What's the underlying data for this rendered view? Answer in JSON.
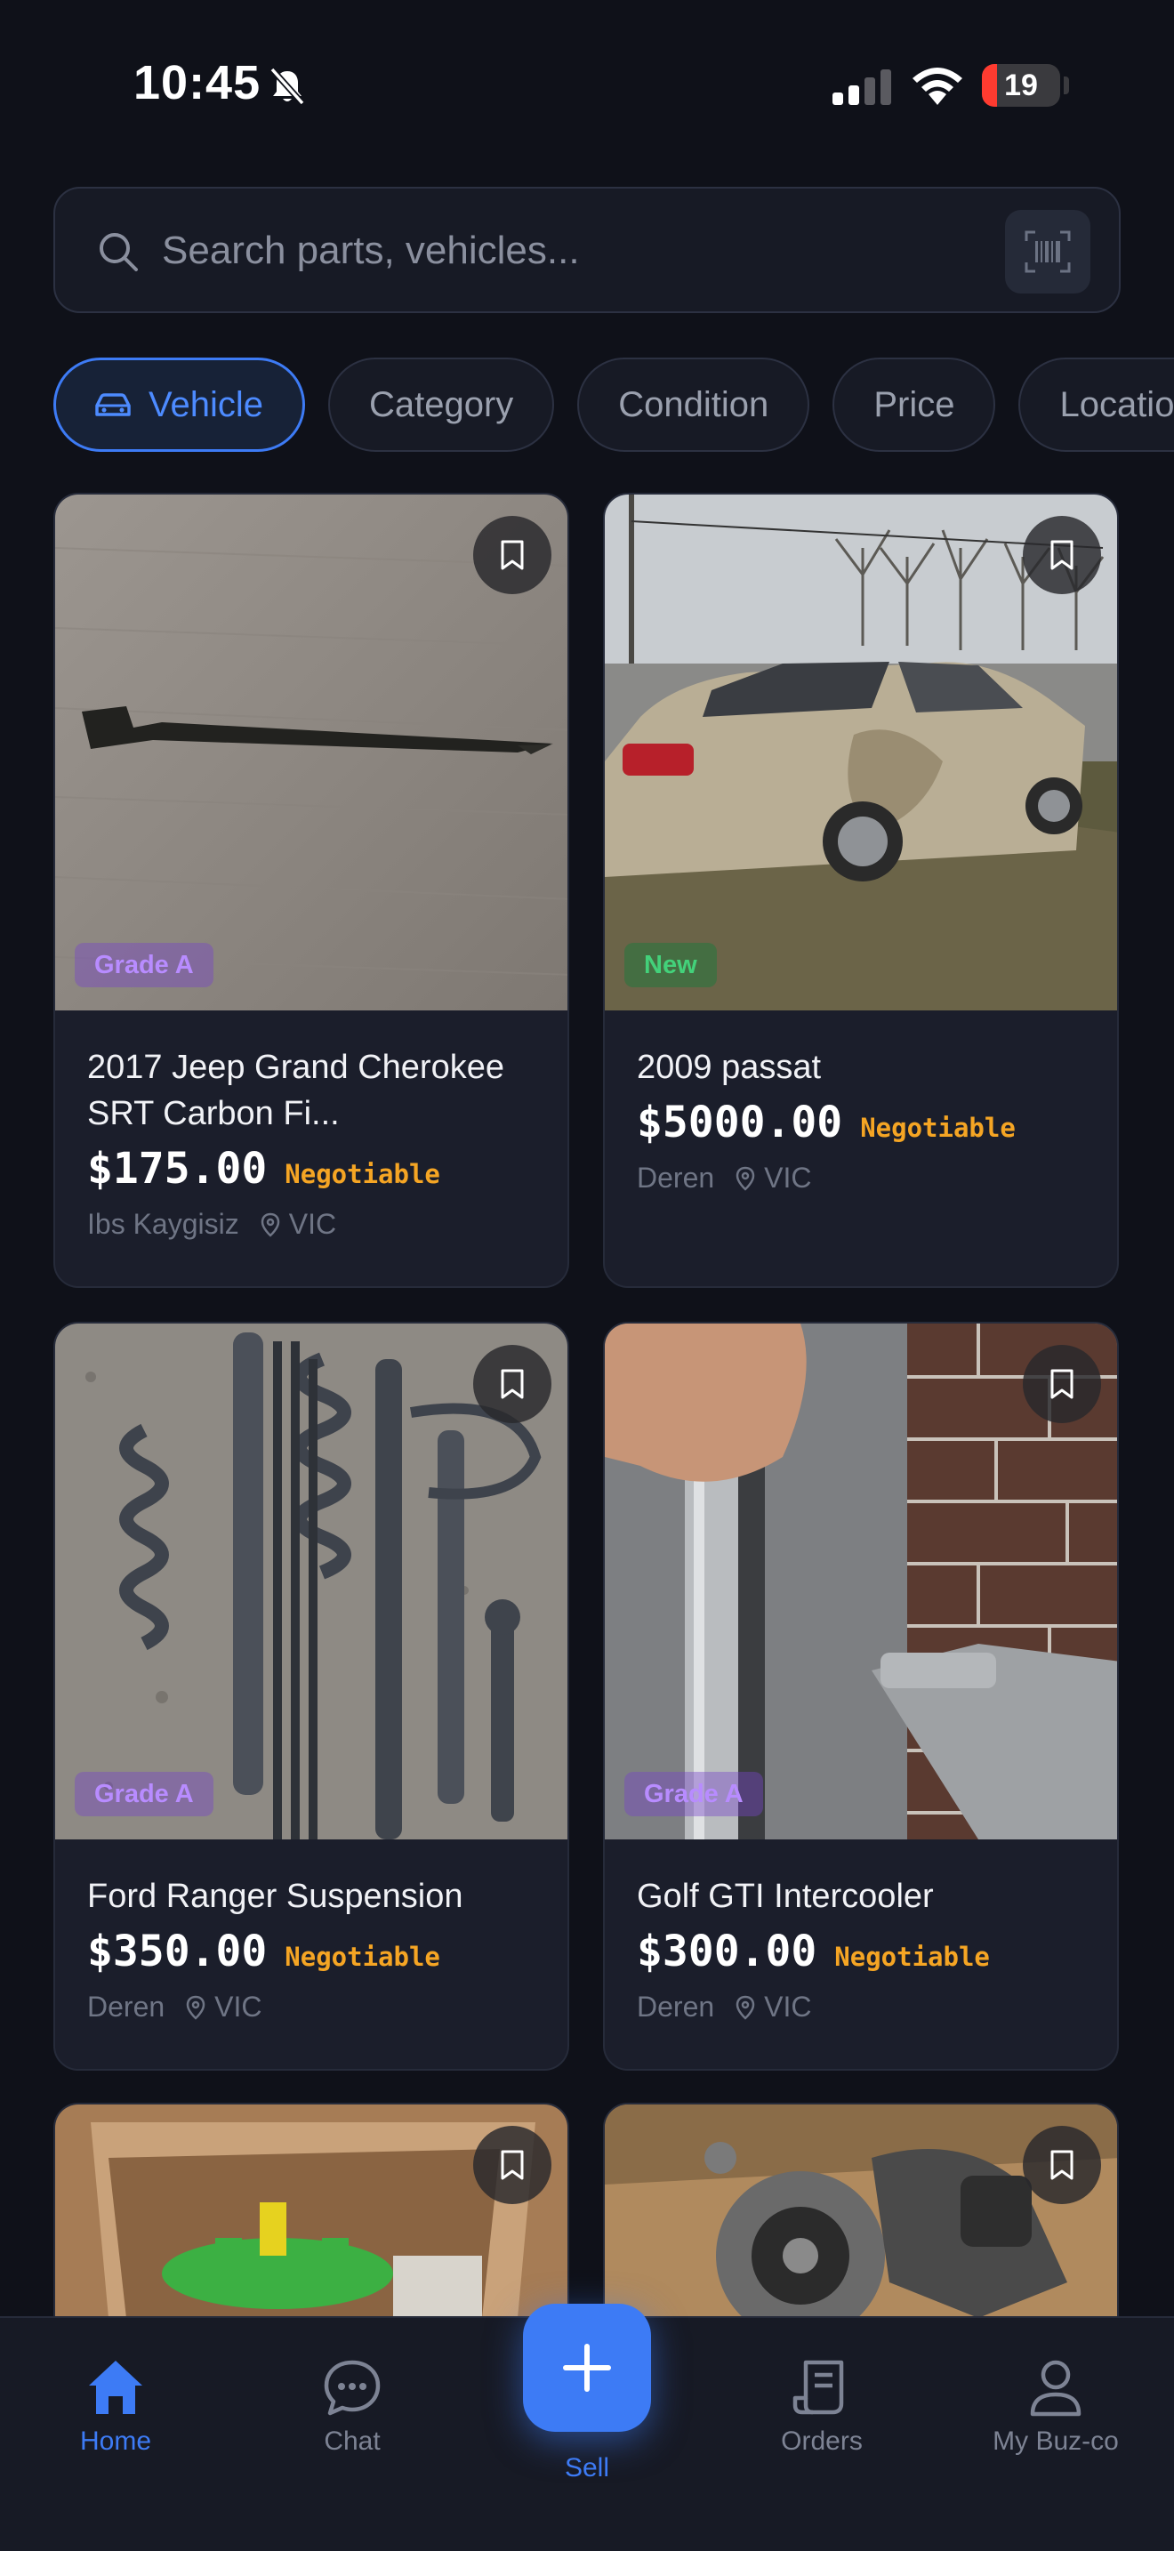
{
  "status_bar": {
    "time": "10:45",
    "battery": "19",
    "battery_level": 0.19
  },
  "search": {
    "placeholder": "Search parts, vehicles..."
  },
  "filters": [
    {
      "label": "Vehicle",
      "active": true
    },
    {
      "label": "Category",
      "active": false
    },
    {
      "label": "Condition",
      "active": false
    },
    {
      "label": "Price",
      "active": false
    },
    {
      "label": "Location",
      "active": false
    }
  ],
  "listings": [
    {
      "title": "2017 Jeep Grand Cherokee SRT Carbon Fi...",
      "price": "$175.00",
      "negotiable": "Negotiable",
      "seller": "Ibs Kaygisiz",
      "location": "VIC",
      "badge": "Grade A"
    },
    {
      "title": "2009 passat",
      "price": "$5000.00",
      "negotiable": "Negotiable",
      "seller": "Deren",
      "location": "VIC",
      "badge": "New"
    },
    {
      "title": "Ford Ranger Suspension",
      "price": "$350.00",
      "negotiable": "Negotiable",
      "seller": "Deren",
      "location": "VIC",
      "badge": "Grade A"
    },
    {
      "title": "Golf GTI Intercooler",
      "price": "$300.00",
      "negotiable": "Negotiable",
      "seller": "Deren",
      "location": "VIC",
      "badge": "Grade A"
    },
    {
      "title": "",
      "price": "",
      "negotiable": "",
      "seller": "",
      "location": "",
      "badge": ""
    },
    {
      "title": "",
      "price": "",
      "negotiable": "",
      "seller": "",
      "location": "",
      "badge": ""
    }
  ],
  "nav": {
    "home": "Home",
    "chat": "Chat",
    "sell": "Sell",
    "orders": "Orders",
    "account": "My Buz-co"
  },
  "colors": {
    "accent": "#3d7bf5",
    "negotiable": "#f5a524",
    "grade_badge": "#b88cff",
    "new_badge": "#43d17a"
  }
}
